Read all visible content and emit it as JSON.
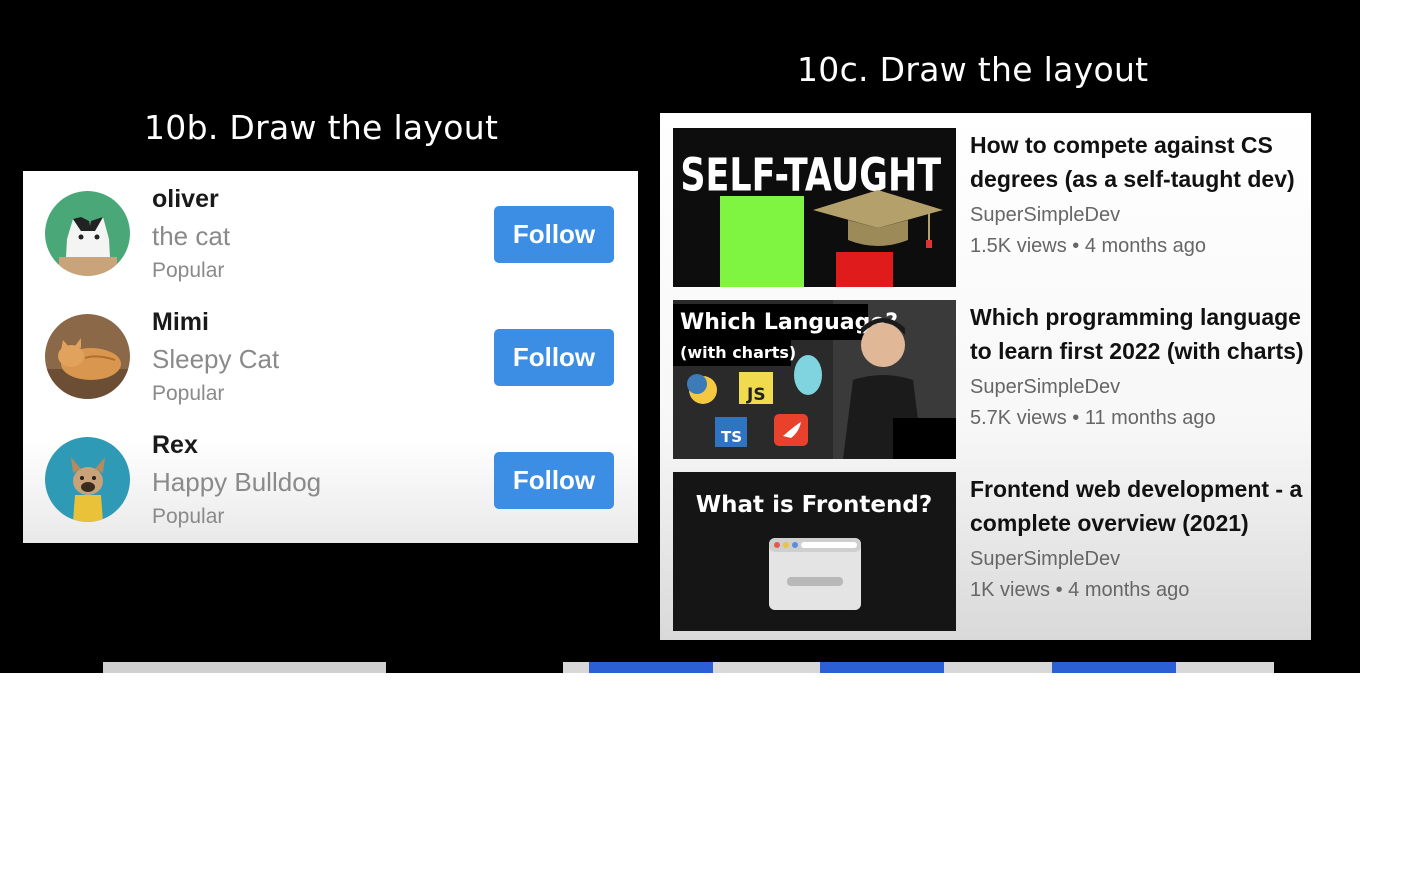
{
  "section_b": {
    "heading": "10b. Draw the layout",
    "profiles": [
      {
        "name": "oliver",
        "description": "the cat",
        "tag": "Popular",
        "button": "Follow",
        "avatar_color": "#4aa878"
      },
      {
        "name": "Mimi",
        "description": "Sleepy Cat",
        "tag": "Popular",
        "button": "Follow",
        "avatar_color": "#b88a5a"
      },
      {
        "name": "Rex",
        "description": "Happy Bulldog",
        "tag": "Popular",
        "button": "Follow",
        "avatar_color": "#2e9ab5"
      }
    ]
  },
  "section_c": {
    "heading": "10c. Draw the layout",
    "videos": [
      {
        "title": "How to compete against CS degrees (as a self-taught dev)",
        "channel": "SuperSimpleDev",
        "stats": "1.5K views • 4 months ago",
        "thumb_text": "SELF-TAUGHT"
      },
      {
        "title": "Which programming language to learn first 2022 (with charts)",
        "channel": "SuperSimpleDev",
        "stats": "5.7K views • 11 months ago",
        "thumb_text": "Which Language?",
        "thumb_subtext": "(with charts)",
        "thumb_badges": [
          "JS",
          "TS"
        ]
      },
      {
        "title": "Frontend web development - a complete overview (2021)",
        "channel": "SuperSimpleDev",
        "stats": "1K views • 4 months ago",
        "thumb_text": "What is Frontend?"
      }
    ]
  },
  "colors": {
    "follow_button": "#3b8ee3",
    "background": "#000000"
  }
}
